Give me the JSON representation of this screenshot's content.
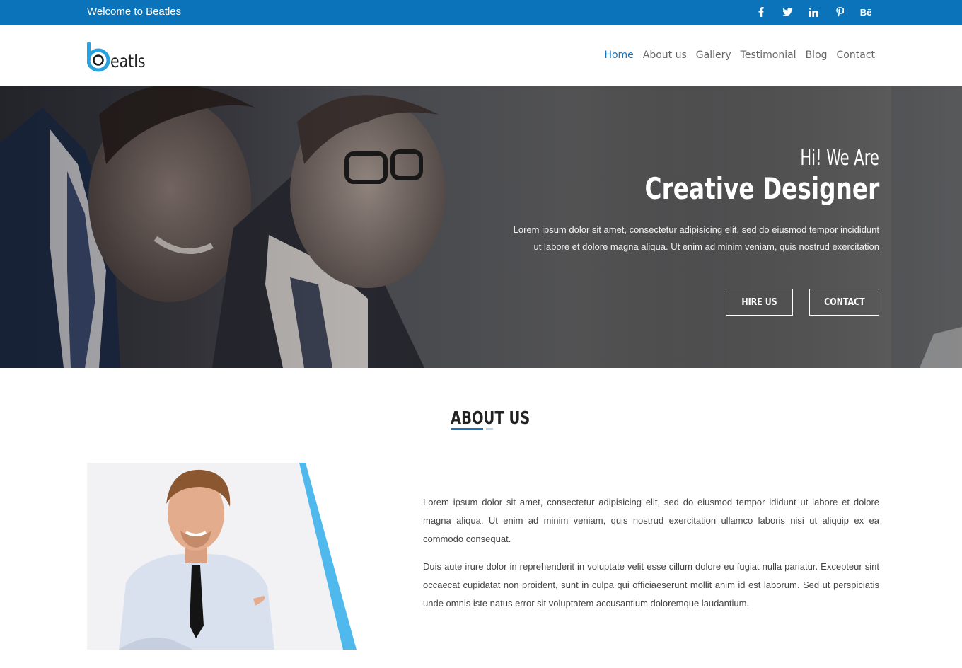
{
  "topbar": {
    "welcome": "Welcome to Beatles",
    "social": [
      {
        "icon": "facebook-icon",
        "glyph": "f"
      },
      {
        "icon": "twitter-icon",
        "glyph": ""
      },
      {
        "icon": "linkedin-icon",
        "glyph": "in"
      },
      {
        "icon": "pinterest-icon",
        "glyph": ""
      },
      {
        "icon": "behance-icon",
        "glyph": "Bē"
      }
    ],
    "background": "#0b73b9"
  },
  "brand": {
    "name": "eatls",
    "accent": "#29a3e0"
  },
  "nav": {
    "items": [
      "Home",
      "About us",
      "Gallery",
      "Testimonial",
      "Blog",
      "Contact"
    ],
    "active": "Home",
    "active_color": "#1d72b5"
  },
  "hero": {
    "kicker": "Hi! We Are",
    "headline": "Creative Designer",
    "lead": "Lorem ipsum dolor sit amet, consectetur adipisicing elit, sed do eiusmod tempor incididunt ut labore et dolore magna aliqua. Ut enim ad minim veniam, quis nostrud exercitation",
    "buttons": {
      "hire": "HIRE US",
      "contact": "CONTACT"
    }
  },
  "about": {
    "title": "ABOUT US",
    "paragraphs": [
      "Lorem ipsum dolor sit amet, consectetur adipisicing elit, sed do eiusmod tempor ididunt ut labore et dolore magna aliqua. Ut enim ad minim veniam, quis nostrud exercitation ullamco laboris nisi ut aliquip ex ea commodo consequat.",
      "Duis aute irure dolor in reprehenderit in voluptate velit esse cillum dolore eu fugiat nulla pariatur. Excepteur sint occaecat cupidatat non proident, sunt in culpa qui officiaeserunt mollit anim id est laborum. Sed ut perspiciatis unde omnis iste natus error sit voluptatem accusantium doloremque laudantium."
    ],
    "stripe_color": "#4fb9ee"
  }
}
